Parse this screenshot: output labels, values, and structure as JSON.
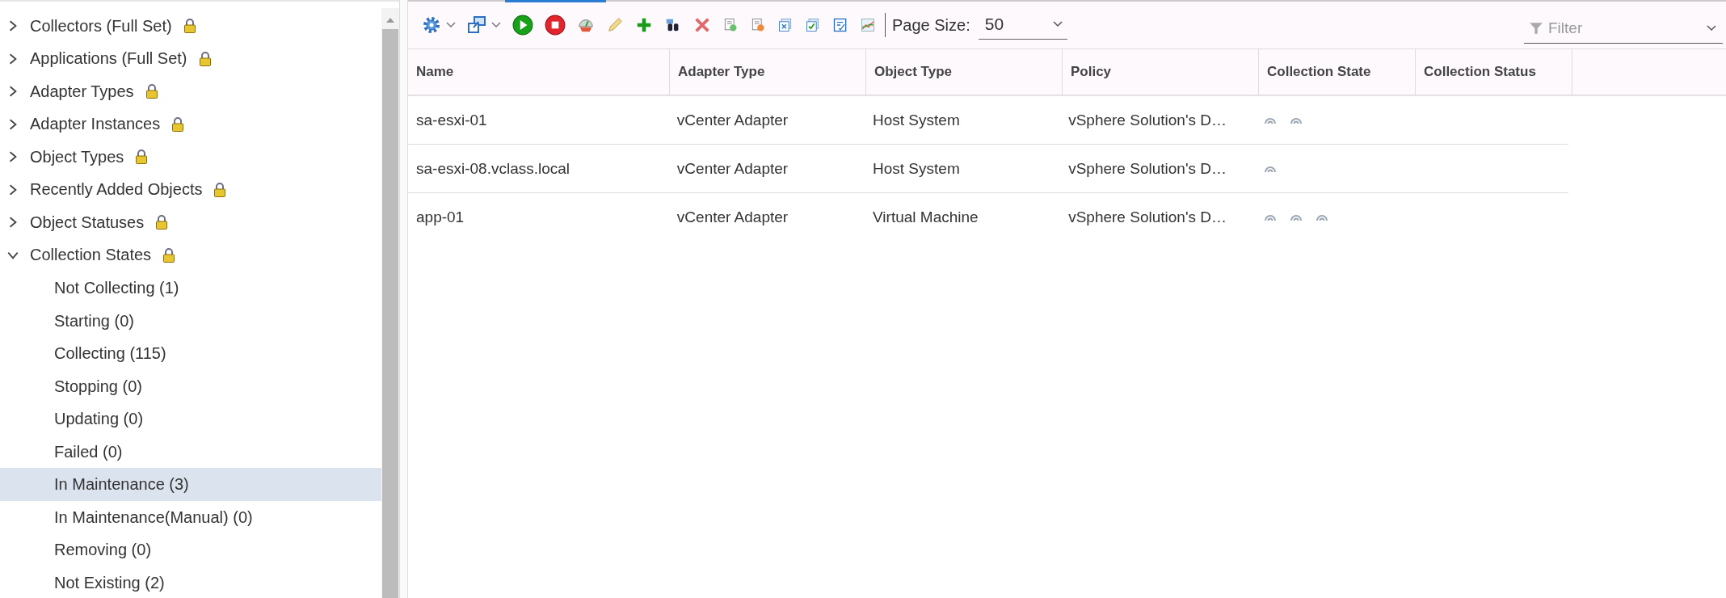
{
  "tree": [
    {
      "label": "Collectors (Full Set)",
      "locked": true,
      "expanded": false
    },
    {
      "label": "Applications (Full Set)",
      "locked": true,
      "expanded": false
    },
    {
      "label": "Adapter Types",
      "locked": true,
      "expanded": false
    },
    {
      "label": "Adapter Instances",
      "locked": true,
      "expanded": false
    },
    {
      "label": "Object Types",
      "locked": true,
      "expanded": false
    },
    {
      "label": "Recently Added Objects",
      "locked": true,
      "expanded": false
    },
    {
      "label": "Object Statuses",
      "locked": true,
      "expanded": false
    },
    {
      "label": "Collection States",
      "locked": true,
      "expanded": true,
      "children": [
        {
          "label": "Not Collecting (1)",
          "selected": false
        },
        {
          "label": "Starting (0)",
          "selected": false
        },
        {
          "label": "Collecting (115)",
          "selected": false
        },
        {
          "label": "Stopping (0)",
          "selected": false
        },
        {
          "label": "Updating (0)",
          "selected": false
        },
        {
          "label": "Failed (0)",
          "selected": false
        },
        {
          "label": "In Maintenance (3)",
          "selected": true
        },
        {
          "label": "In Maintenance(Manual) (0)",
          "selected": false
        },
        {
          "label": "Removing (0)",
          "selected": false
        },
        {
          "label": "Not Existing (2)",
          "selected": false
        }
      ]
    }
  ],
  "toolbar": {
    "page_size_label": "Page Size:",
    "page_size": "50",
    "filter_placeholder": "Filter"
  },
  "table": {
    "columns": [
      "Name",
      "Adapter Type",
      "Object Type",
      "Policy",
      "Collection State",
      "Collection Status"
    ],
    "rows": [
      {
        "name": "sa-esxi-01",
        "adapter_type": "vCenter Adapter",
        "object_type": "Host System",
        "policy": "vSphere Solution's D…",
        "collection_state": [
          {
            "kind": "maintenance"
          },
          {
            "kind": "maintenance"
          }
        ]
      },
      {
        "name": "sa-esxi-08.vclass.local",
        "adapter_type": "vCenter Adapter",
        "object_type": "Host System",
        "policy": "vSphere Solution's D…",
        "collection_state": [
          {
            "kind": "maintenance"
          }
        ]
      },
      {
        "name": "app-01",
        "adapter_type": "vCenter Adapter",
        "object_type": "Virtual Machine",
        "policy": "vSphere Solution's D…",
        "collection_state": [
          {
            "kind": "maintenance"
          },
          {
            "kind": "maintenance"
          },
          {
            "kind": "maintenance"
          }
        ]
      }
    ]
  }
}
